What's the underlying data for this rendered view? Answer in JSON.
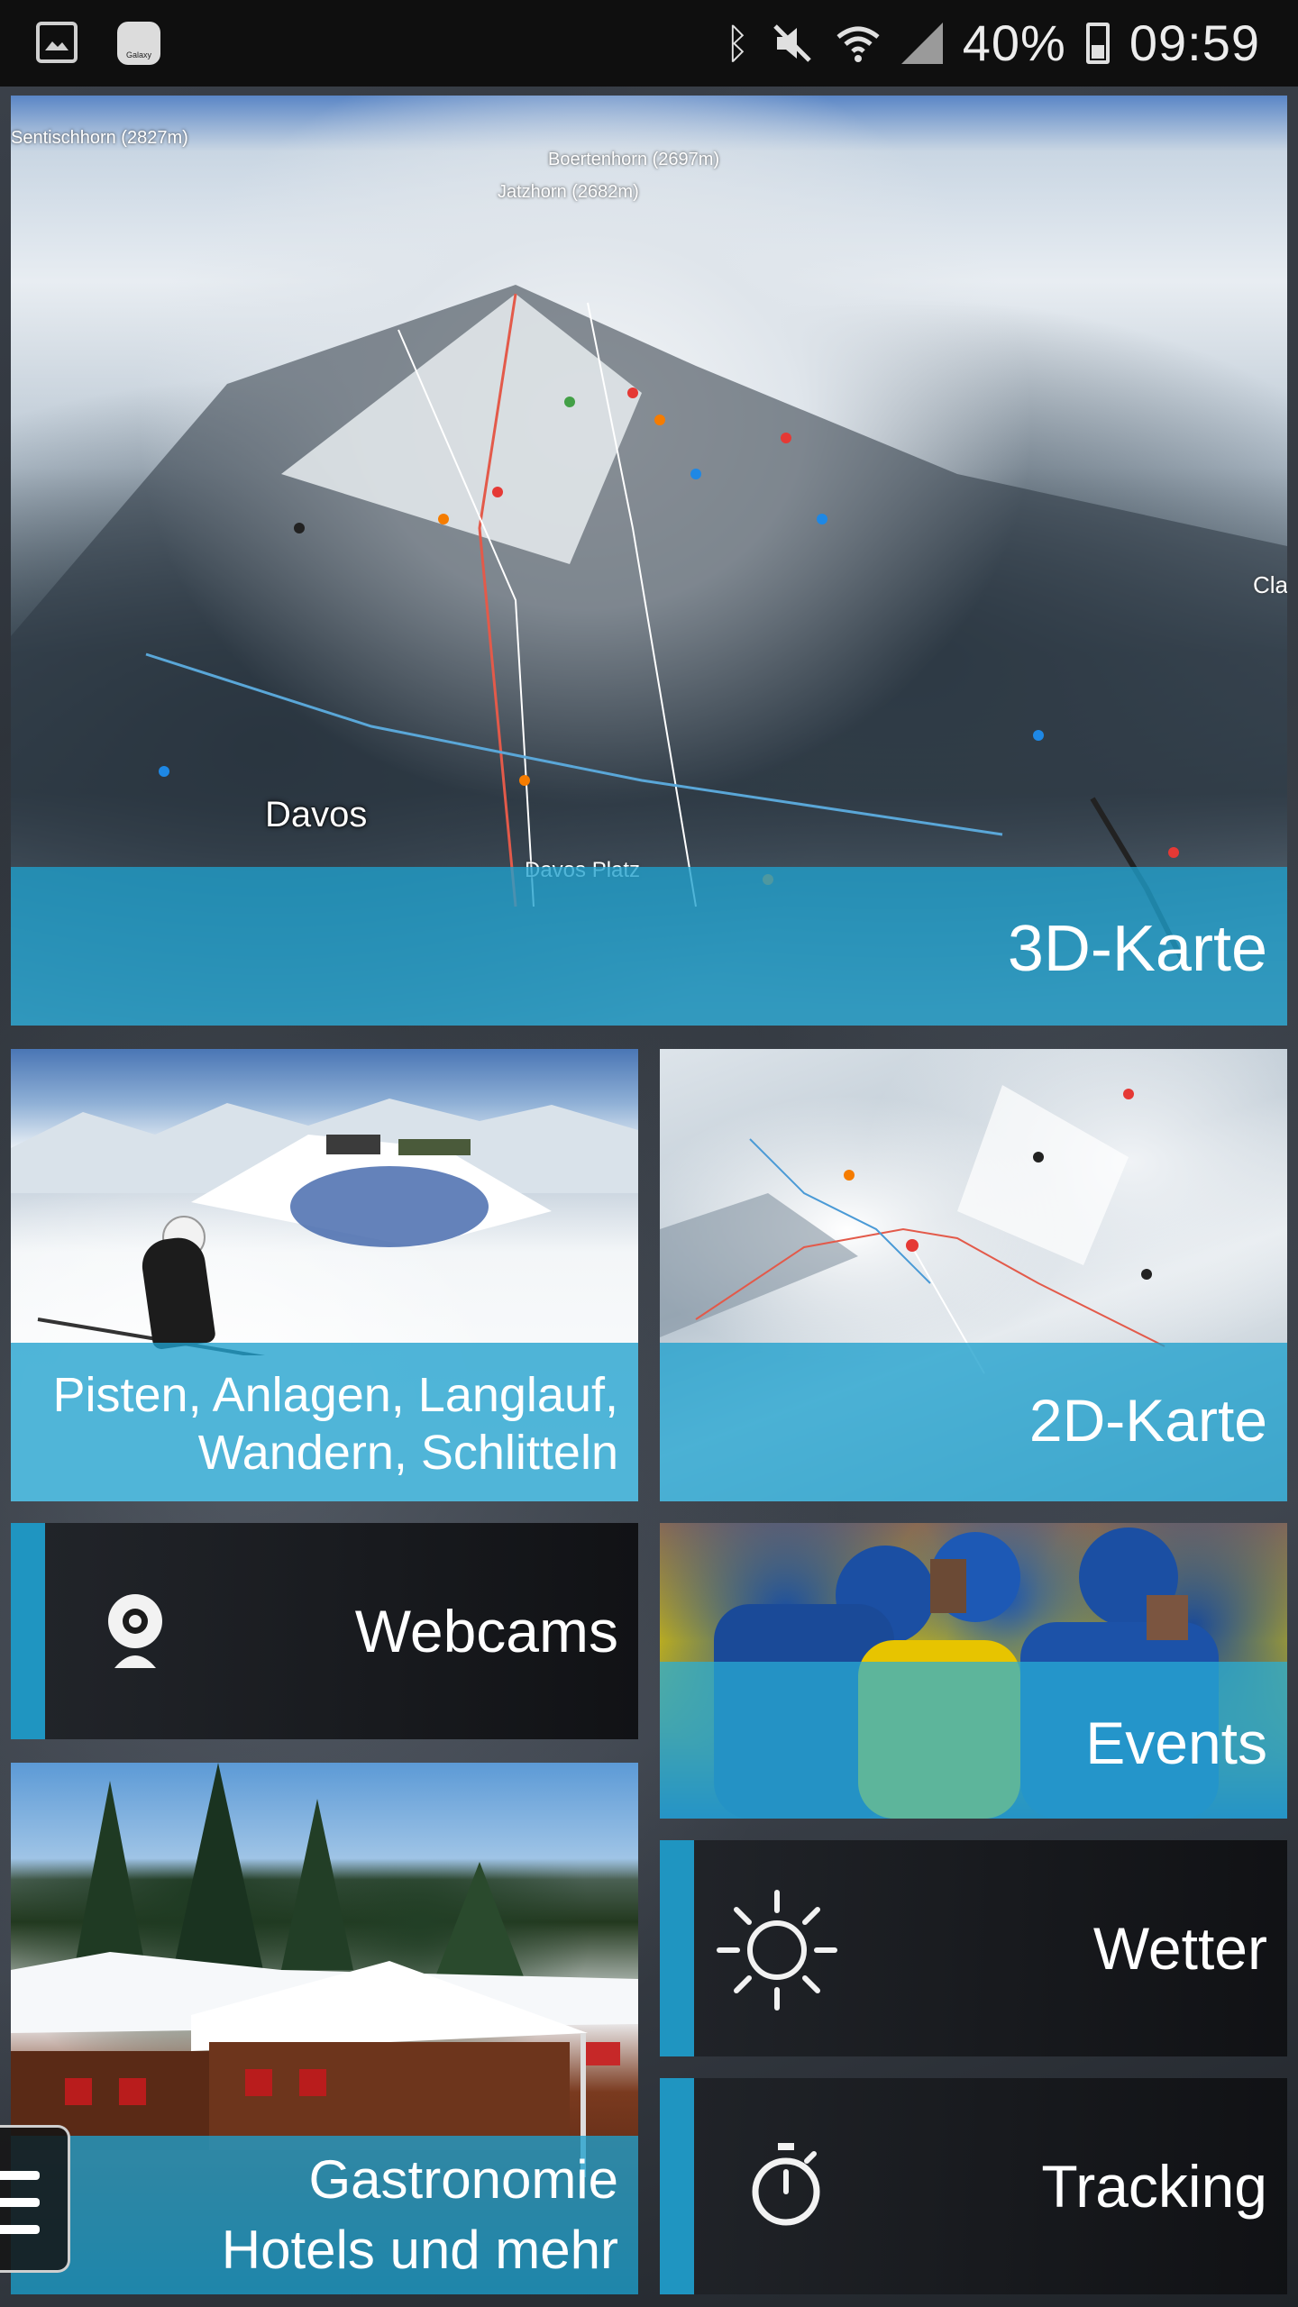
{
  "status_bar": {
    "battery": "40%",
    "time": "09:59",
    "galaxy_label": "Galaxy",
    "icons": [
      "gallery-icon",
      "galaxy-app-icon",
      "bluetooth-icon",
      "mute-icon",
      "wifi-icon",
      "signal-icon",
      "battery-icon"
    ]
  },
  "tiles": {
    "map3d": {
      "label": "3D-Karte",
      "peaks": [
        "Sentischhorn (2827m)",
        "Boertenhorn (2697m)",
        "Jatzhorn (2682m)"
      ],
      "places": [
        "Davos",
        "Davos Platz",
        "Cla"
      ]
    },
    "pisten": {
      "line1": "Pisten, Anlagen, Langlauf,",
      "line2": "Wandern, Schlitteln"
    },
    "map2d": {
      "label": "2D-Karte"
    },
    "webcams": {
      "label": "Webcams",
      "icon": "webcam-icon"
    },
    "events": {
      "label": "Events"
    },
    "wetter": {
      "label": "Wetter",
      "icon": "sun-icon"
    },
    "gastro": {
      "line1": "Gastronomie",
      "line2": "Hotels und mehr"
    },
    "tracking": {
      "label": "Tracking",
      "icon": "stopwatch-icon"
    }
  },
  "colors": {
    "accent": "#1f95c1",
    "band": "#1fa0cd",
    "dark_tile": "#1a1c20"
  }
}
